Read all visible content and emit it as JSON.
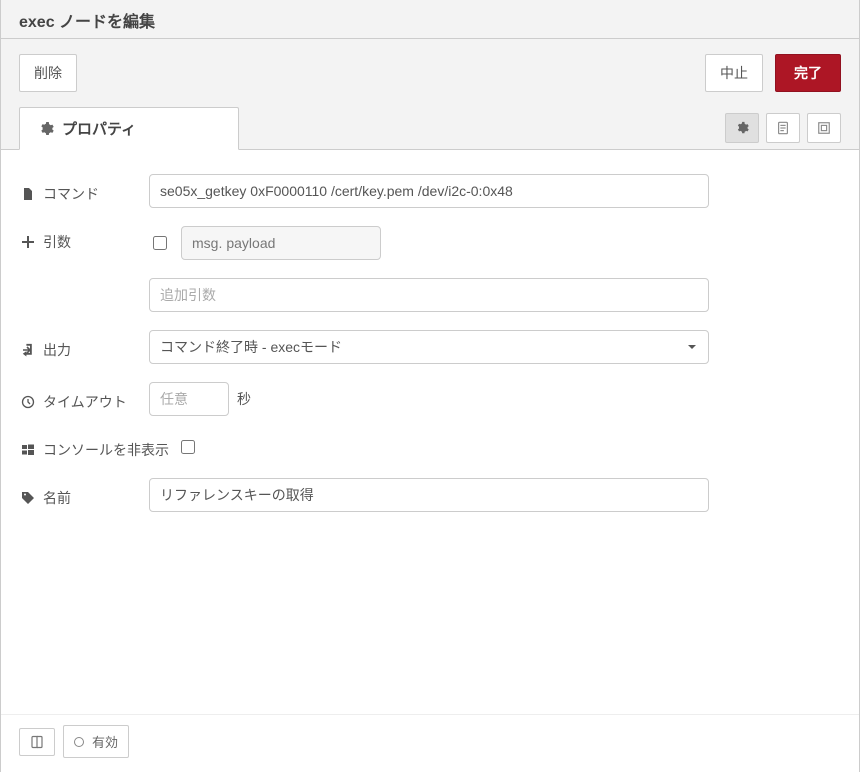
{
  "header": {
    "title": "exec ノードを編集"
  },
  "buttons": {
    "delete": "削除",
    "cancel": "中止",
    "done": "完了"
  },
  "tabs": {
    "properties_label": "プロパティ"
  },
  "form": {
    "command": {
      "label": "コマンド",
      "value": "se05x_getkey 0xF0000110 /cert/key.pem /dev/i2c-0:0x48"
    },
    "args": {
      "label": "引数",
      "append_checked": false,
      "msg_prefix": "msg.",
      "msg_field": "payload",
      "extra_placeholder": "追加引数",
      "extra_value": ""
    },
    "output": {
      "label": "出力",
      "selected": "コマンド終了時 - execモード"
    },
    "timeout": {
      "label": "タイムアウト",
      "placeholder": "任意",
      "value": "",
      "unit": "秒"
    },
    "hide_console": {
      "label": "コンソールを非表示",
      "checked": false
    },
    "name": {
      "label": "名前",
      "value": "リファレンスキーの取得"
    }
  },
  "footer": {
    "enabled_label": "有効"
  }
}
